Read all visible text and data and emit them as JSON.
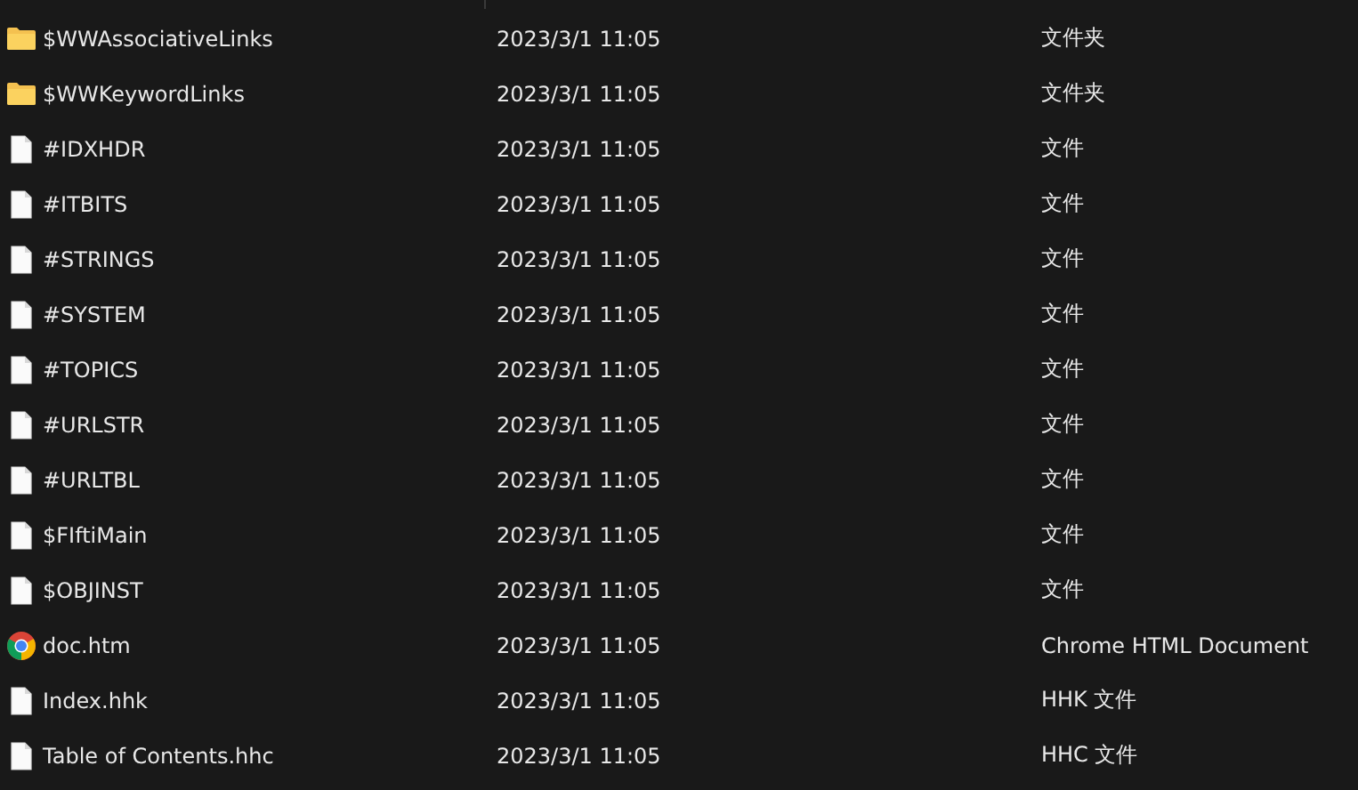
{
  "files": [
    {
      "kind": "folder",
      "name": "$WWAssociativeLinks",
      "date": "2023/3/1 11:05",
      "type": "文件夹"
    },
    {
      "kind": "folder",
      "name": "$WWKeywordLinks",
      "date": "2023/3/1 11:05",
      "type": "文件夹"
    },
    {
      "kind": "file",
      "name": "#IDXHDR",
      "date": "2023/3/1 11:05",
      "type": "文件"
    },
    {
      "kind": "file",
      "name": "#ITBITS",
      "date": "2023/3/1 11:05",
      "type": "文件"
    },
    {
      "kind": "file",
      "name": "#STRINGS",
      "date": "2023/3/1 11:05",
      "type": "文件"
    },
    {
      "kind": "file",
      "name": "#SYSTEM",
      "date": "2023/3/1 11:05",
      "type": "文件"
    },
    {
      "kind": "file",
      "name": "#TOPICS",
      "date": "2023/3/1 11:05",
      "type": "文件"
    },
    {
      "kind": "file",
      "name": "#URLSTR",
      "date": "2023/3/1 11:05",
      "type": "文件"
    },
    {
      "kind": "file",
      "name": "#URLTBL",
      "date": "2023/3/1 11:05",
      "type": "文件"
    },
    {
      "kind": "file",
      "name": "$FIftiMain",
      "date": "2023/3/1 11:05",
      "type": "文件"
    },
    {
      "kind": "file",
      "name": "$OBJINST",
      "date": "2023/3/1 11:05",
      "type": "文件"
    },
    {
      "kind": "browser",
      "name": "doc.htm",
      "date": "2023/3/1 11:05",
      "type": "Chrome HTML Document"
    },
    {
      "kind": "file",
      "name": "Index.hhk",
      "date": "2023/3/1 11:05",
      "type": "HHK 文件"
    },
    {
      "kind": "file",
      "name": "Table of Contents.hhc",
      "date": "2023/3/1 11:05",
      "type": "HHC 文件"
    }
  ]
}
